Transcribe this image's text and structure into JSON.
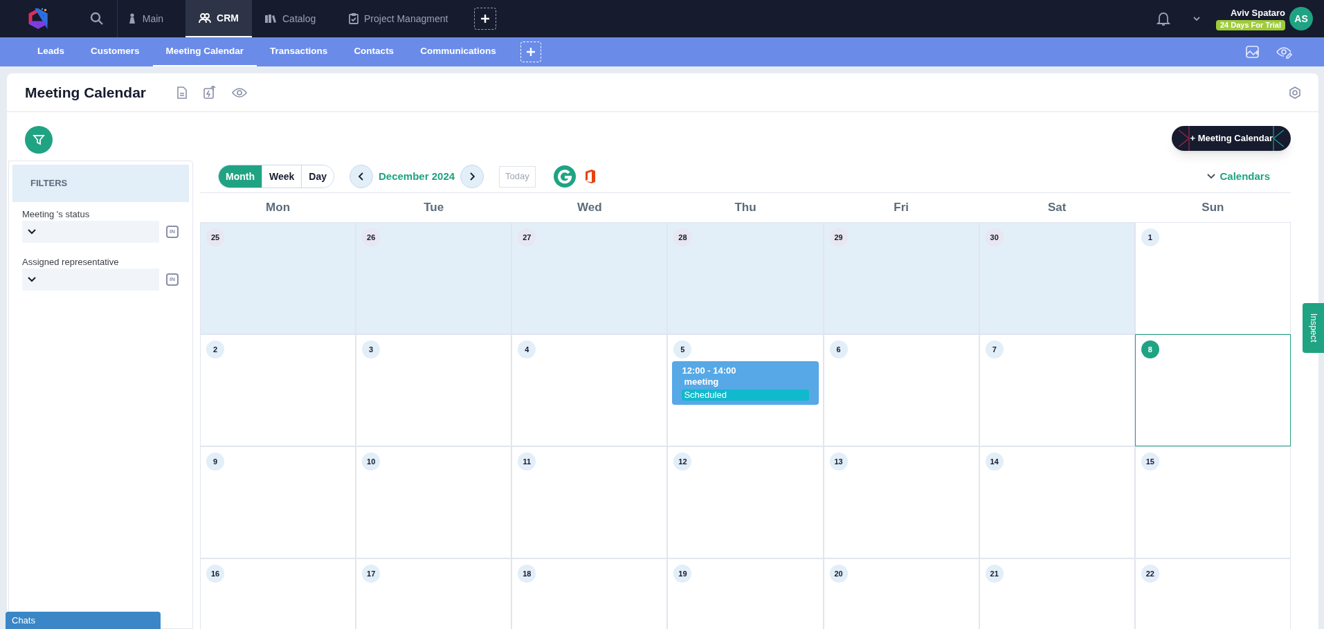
{
  "top_nav": {
    "tabs": [
      {
        "label": "Main",
        "selected": false
      },
      {
        "label": "CRM",
        "selected": true
      },
      {
        "label": "Catalog",
        "selected": false
      },
      {
        "label": "Project Managment",
        "selected": false
      }
    ],
    "user": {
      "name": "Aviv Spataro",
      "trial_badge": "24 Days For Trial",
      "initials": "AS"
    }
  },
  "sub_nav": {
    "tabs": [
      {
        "label": "Leads",
        "selected": false
      },
      {
        "label": "Customers",
        "selected": false
      },
      {
        "label": "Meeting Calendar",
        "selected": true
      },
      {
        "label": "Transactions",
        "selected": false
      },
      {
        "label": "Contacts",
        "selected": false
      },
      {
        "label": "Communications",
        "selected": false
      }
    ]
  },
  "page": {
    "title": "Meeting Calendar",
    "add_button": "+ Meeting Calendar"
  },
  "filters": {
    "title": "FILTERS",
    "fields": [
      {
        "label": "Meeting 's status",
        "toggle": "IN"
      },
      {
        "label": "Assigned representative",
        "toggle": "IN"
      }
    ]
  },
  "calendar": {
    "views": [
      {
        "label": "Month",
        "selected": true
      },
      {
        "label": "Week",
        "selected": false
      },
      {
        "label": "Day",
        "selected": false
      }
    ],
    "period": "December 2024",
    "today_button": "Today",
    "calendars_toggle": "Calendars",
    "weekdays": [
      "Mon",
      "Tue",
      "Wed",
      "Thu",
      "Fri",
      "Sat",
      "Sun"
    ],
    "weeks": [
      [
        {
          "day": "25",
          "outside": true,
          "today": false
        },
        {
          "day": "26",
          "outside": true,
          "today": false
        },
        {
          "day": "27",
          "outside": true,
          "today": false
        },
        {
          "day": "28",
          "outside": true,
          "today": false
        },
        {
          "day": "29",
          "outside": true,
          "today": false
        },
        {
          "day": "30",
          "outside": true,
          "today": false
        },
        {
          "day": "1",
          "outside": false,
          "today": false
        }
      ],
      [
        {
          "day": "2",
          "outside": false,
          "today": false
        },
        {
          "day": "3",
          "outside": false,
          "today": false
        },
        {
          "day": "4",
          "outside": false,
          "today": false
        },
        {
          "day": "5",
          "outside": false,
          "today": false,
          "events": [
            {
              "time": "12:00 - 14:00",
              "title": "meeting",
              "status": "Scheduled"
            }
          ]
        },
        {
          "day": "6",
          "outside": false,
          "today": false
        },
        {
          "day": "7",
          "outside": false,
          "today": false
        },
        {
          "day": "8",
          "outside": false,
          "today": true
        }
      ],
      [
        {
          "day": "9",
          "outside": false,
          "today": false
        },
        {
          "day": "10",
          "outside": false,
          "today": false
        },
        {
          "day": "11",
          "outside": false,
          "today": false
        },
        {
          "day": "12",
          "outside": false,
          "today": false
        },
        {
          "day": "13",
          "outside": false,
          "today": false
        },
        {
          "day": "14",
          "outside": false,
          "today": false
        },
        {
          "day": "15",
          "outside": false,
          "today": false
        }
      ],
      [
        {
          "day": "16",
          "outside": false,
          "today": false
        },
        {
          "day": "17",
          "outside": false,
          "today": false
        },
        {
          "day": "18",
          "outside": false,
          "today": false
        },
        {
          "day": "19",
          "outside": false,
          "today": false
        },
        {
          "day": "20",
          "outside": false,
          "today": false
        },
        {
          "day": "21",
          "outside": false,
          "today": false
        },
        {
          "day": "22",
          "outside": false,
          "today": false
        }
      ]
    ]
  },
  "chats_button": "Chats",
  "inspect_tab": "Inspect"
}
